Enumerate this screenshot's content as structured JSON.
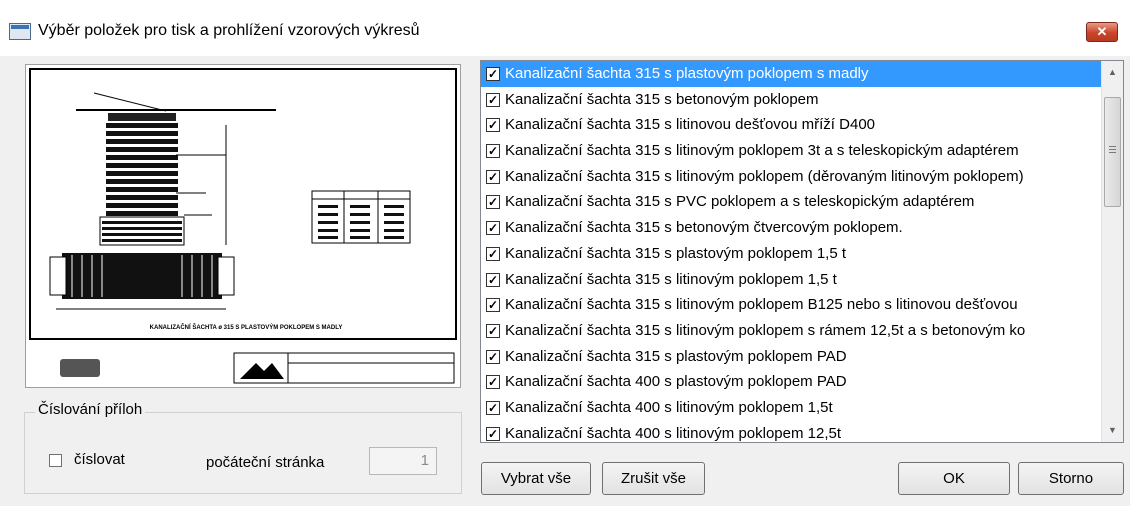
{
  "window": {
    "title": "Výběr položek pro tisk a prohlížení vzorových výkresů",
    "app_icon": "window-app-icon",
    "close_icon": "close-x-icon"
  },
  "preview": {
    "drawing_caption": "KANALIZAČNÍ ŠACHTA ø 315 S PLASTOVÝM POKLOPEM S MADLY"
  },
  "numbering": {
    "group_label": "Číslování příloh",
    "checkbox_label": "číslovat",
    "checkbox_checked": false,
    "start_page_label": "počáteční stránka",
    "start_page_value": "1"
  },
  "items": [
    {
      "label": "Kanalizační šachta 315 s plastovým poklopem s madly",
      "checked": true,
      "selected": true
    },
    {
      "label": "Kanalizační šachta 315 s betonovým poklopem",
      "checked": true
    },
    {
      "label": "Kanalizační šachta 315 s litinovou dešťovou mříží D400",
      "checked": true
    },
    {
      "label": "Kanalizační šachta 315 s litinovým poklopem 3t a s teleskopickým adaptérem",
      "checked": true
    },
    {
      "label": "Kanalizační šachta 315 s litinovým poklopem (děrovaným litinovým poklopem)",
      "checked": true
    },
    {
      "label": "Kanalizační šachta 315 s PVC poklopem a s teleskopickým adaptérem",
      "checked": true
    },
    {
      "label": "Kanalizační šachta 315 s betonovým čtvercovým poklopem.",
      "checked": true
    },
    {
      "label": "Kanalizační šachta 315 s plastovým poklopem 1,5 t",
      "checked": true
    },
    {
      "label": "Kanalizační šachta 315 s litinovým poklopem 1,5 t",
      "checked": true
    },
    {
      "label": "Kanalizační šachta 315 s litinovým poklopem B125 nebo s litinovou dešťovou",
      "checked": true
    },
    {
      "label": "Kanalizační šachta 315 s litinovým poklopem s rámem 12,5t a s betonovým ko",
      "checked": true
    },
    {
      "label": "Kanalizační šachta 315 s plastovým poklopem PAD",
      "checked": true
    },
    {
      "label": "Kanalizační šachta 400 s plastovým poklopem PAD",
      "checked": true
    },
    {
      "label": "Kanalizační šachta 400 s litinovým poklopem 1,5t",
      "checked": true
    },
    {
      "label": "Kanalizační šachta 400 s litinovým poklopem 12,5t",
      "checked": true
    }
  ],
  "buttons": {
    "select_all": "Vybrat vše",
    "deselect_all": "Zrušit vše",
    "ok": "OK",
    "cancel": "Storno"
  },
  "colors": {
    "selection": "#3399ff",
    "close_button": "#c9442a"
  }
}
